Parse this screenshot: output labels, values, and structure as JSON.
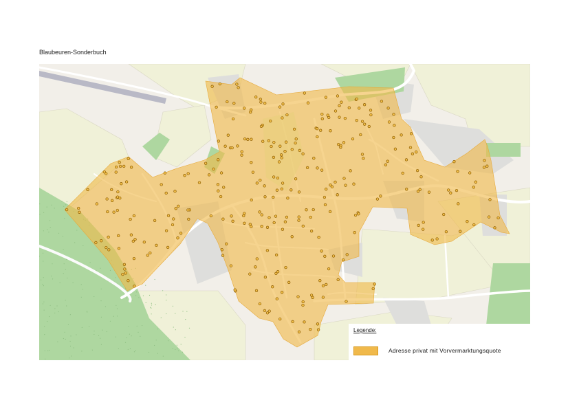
{
  "page": {
    "title": "Blaubeuren-Sonderbuch"
  },
  "legend": {
    "title": "Legende:",
    "items": [
      {
        "label": "Adresse privat mit Vorvermarktungsquote",
        "color": "#f0b94b"
      }
    ]
  },
  "colors": {
    "coverage_fill": "#f0b94b",
    "address_dot": "#f3c04a",
    "address_dot_stroke": "#8a5a00",
    "forest": "#a8d49b",
    "farmland": "#eef0d6",
    "residential": "#dcdcdc",
    "road": "#ffffff"
  }
}
